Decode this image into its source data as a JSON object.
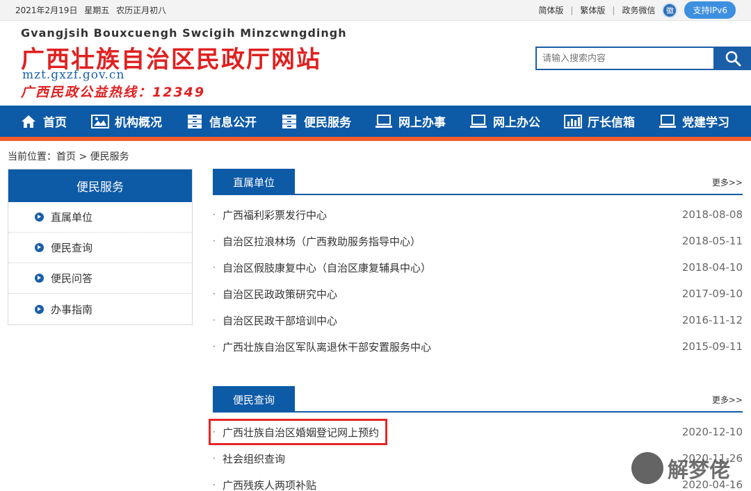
{
  "topbar": {
    "date": "2021年2月19日",
    "weekday": "星期五",
    "lunar": "农历正月初八",
    "links": [
      "简体版",
      "繁体版",
      "政务微信"
    ],
    "separator": "|",
    "wechat_badge": "徽",
    "ipv6": "支持IPv6"
  },
  "header": {
    "zhuang_name": "Gvangjsih Bouxcuengh Swcigih Minzcwngdingh",
    "title": "广西壮族自治区民政厅网站",
    "url": "mzt.gxzf.gov.cn",
    "hotline": "广西民政公益热线：12349",
    "search_placeholder": "请输入搜索内容"
  },
  "nav": [
    {
      "label": "首页",
      "icon": "home-icon"
    },
    {
      "label": "机构概况",
      "icon": "image-icon"
    },
    {
      "label": "信息公开",
      "icon": "cabinet-icon"
    },
    {
      "label": "便民服务",
      "icon": "cabinet-icon"
    },
    {
      "label": "网上办事",
      "icon": "laptop-icon"
    },
    {
      "label": "网上办公",
      "icon": "laptop-icon"
    },
    {
      "label": "厅长信箱",
      "icon": "bar-chart-icon"
    },
    {
      "label": "党建学习",
      "icon": "laptop-icon"
    }
  ],
  "breadcrumb": "当前位置：首页 > 便民服务",
  "sidebar": {
    "title": "便民服务",
    "items": [
      "直属单位",
      "便民查询",
      "便民问答",
      "办事指南"
    ]
  },
  "sections": [
    {
      "title": "直属单位",
      "more": "更多>>",
      "rows": [
        {
          "title": "广西福利彩票发行中心",
          "date": "2018-08-08"
        },
        {
          "title": "自治区拉浪林场（广西救助服务指导中心）",
          "date": "2018-05-11"
        },
        {
          "title": "自治区假肢康复中心（自治区康复辅具中心）",
          "date": "2018-04-10"
        },
        {
          "title": "自治区民政政策研究中心",
          "date": "2017-09-10"
        },
        {
          "title": "自治区民政干部培训中心",
          "date": "2016-11-12"
        },
        {
          "title": "广西壮族自治区军队离退休干部安置服务中心",
          "date": "2015-09-11"
        }
      ]
    },
    {
      "title": "便民查询",
      "more": "更多>>",
      "rows": [
        {
          "title": "广西壮族自治区婚姻登记网上预约",
          "date": "2020-12-10"
        },
        {
          "title": "社会组织查询",
          "date": "2020-11-26"
        },
        {
          "title": "广西残疾人两项补贴",
          "date": "2020-04-16"
        }
      ]
    }
  ],
  "watermark": "解梦佬",
  "colors": {
    "primary": "#0d5aa7",
    "accent": "#f25a2a",
    "red": "#e02020"
  }
}
